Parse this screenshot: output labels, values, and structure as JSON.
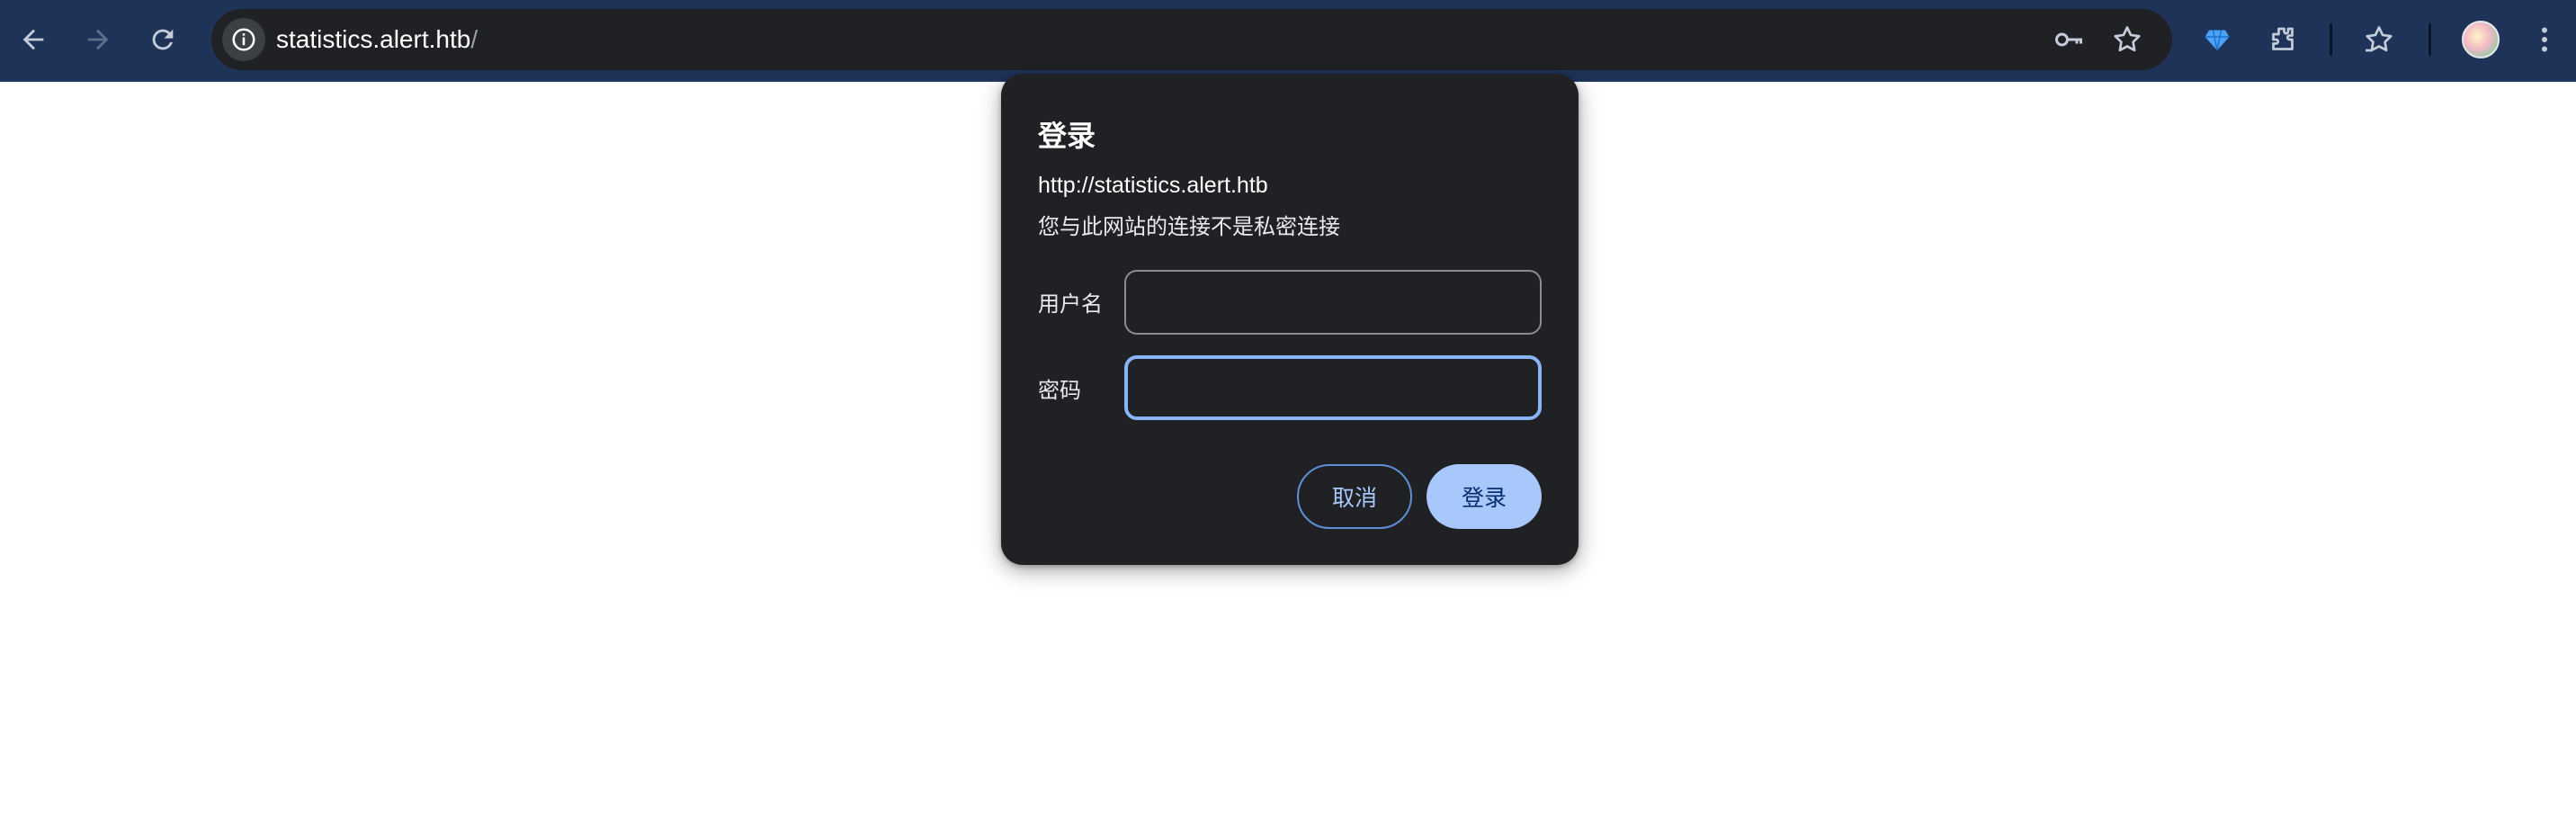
{
  "browser": {
    "toolbar_color": "#1f3359",
    "address_bar": {
      "host": "statistics.alert.htb",
      "path": "/"
    },
    "icons": {
      "back": "back-arrow-icon",
      "forward": "forward-arrow-icon",
      "reload": "reload-icon",
      "site_info": "info-icon",
      "passwords": "key-icon",
      "bookmark": "star-icon",
      "extension_gem": "gem-icon",
      "extensions": "puzzle-icon",
      "bookmarks_list": "star-list-icon",
      "profile": "avatar",
      "menu": "kebab-menu-icon"
    }
  },
  "dialog": {
    "title": "登录",
    "origin": "http://statistics.alert.htb",
    "warning": "您与此网站的连接不是私密连接",
    "username_label": "用户名",
    "username_value": "",
    "password_label": "密码",
    "password_value": "",
    "cancel_label": "取消",
    "submit_label": "登录",
    "accent_color": "#a8c7fa"
  }
}
